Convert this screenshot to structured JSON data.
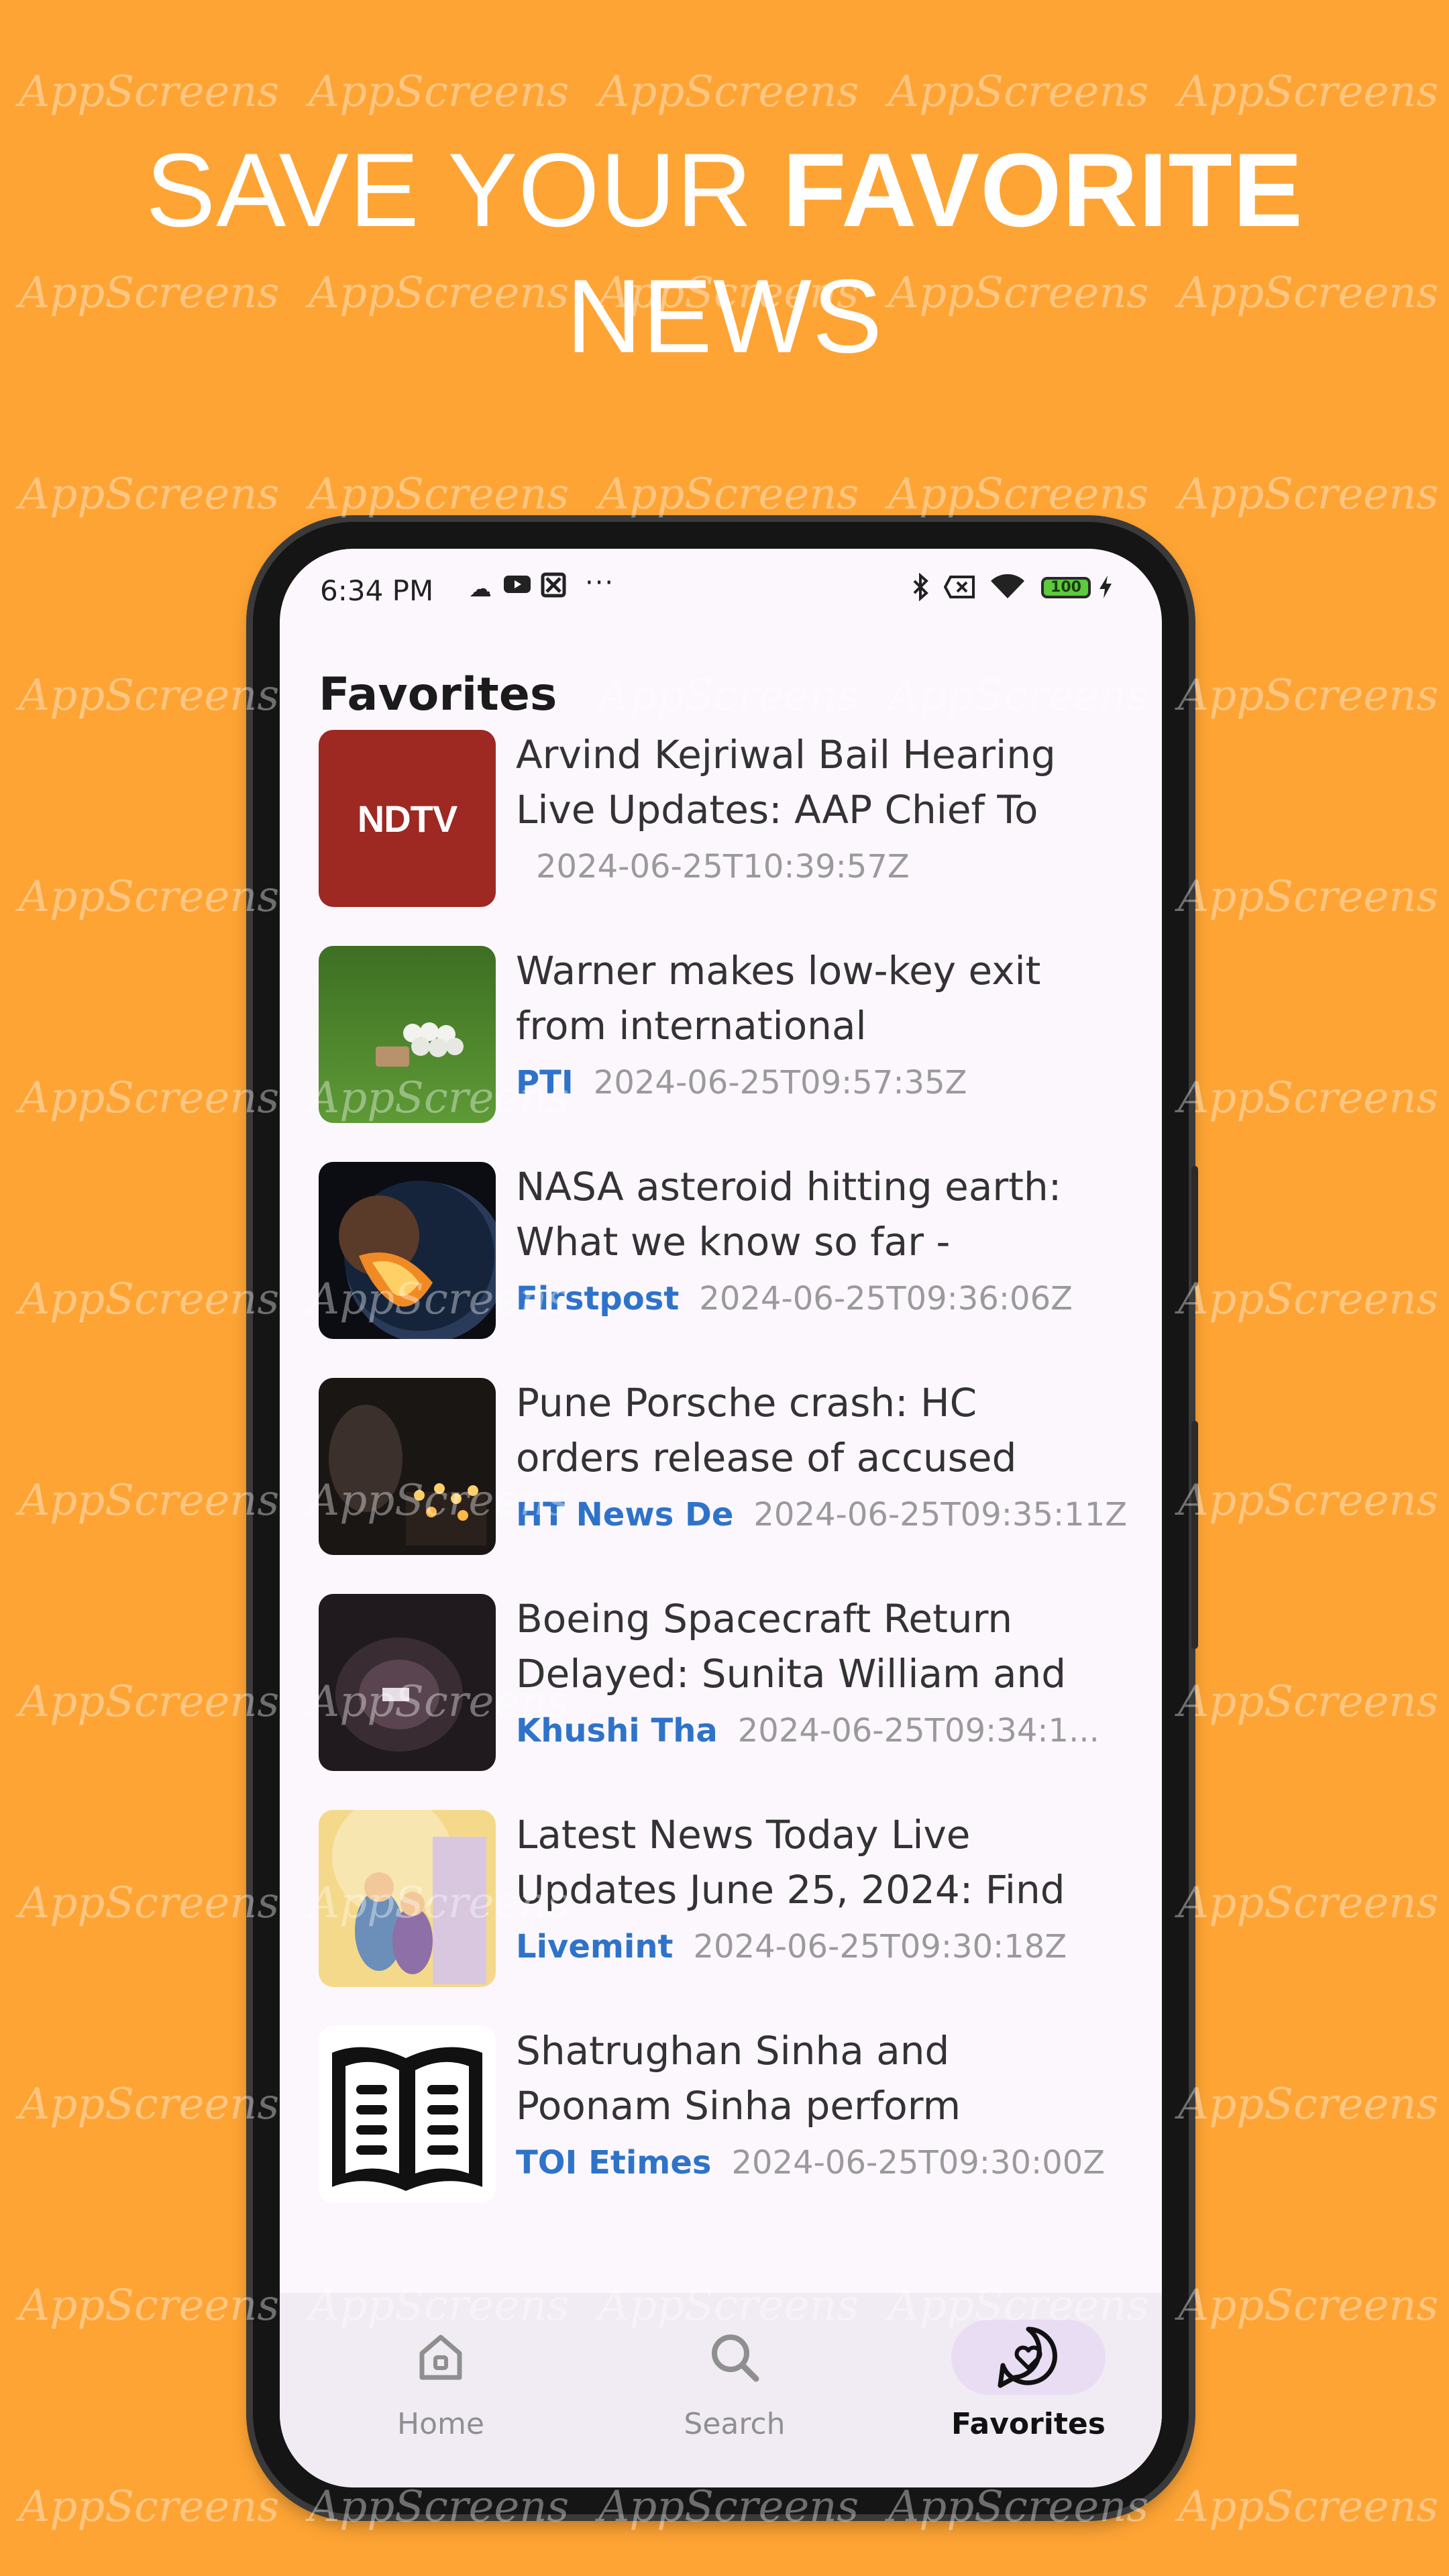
{
  "watermark": "AppScreens",
  "headline": {
    "prefix": "SAVE YOUR ",
    "bold": "FAVORITE",
    "line2": "NEWS"
  },
  "status_bar": {
    "time": "6:34 PM",
    "battery": "100"
  },
  "page_title": "Favorites",
  "articles": [
    {
      "title": "Arvind Kejriwal Bail Hearing Live Updates: AAP Chief To",
      "source": "",
      "date": "2024-06-25T10:39:57Z",
      "thumb_text": "NDTV"
    },
    {
      "title": "Warner makes low-key exit from international",
      "source": "PTI",
      "date": "2024-06-25T09:57:35Z"
    },
    {
      "title": "NASA asteroid hitting earth: What we know so far -",
      "source": "Firstpost",
      "date": "2024-06-25T09:36:06Z"
    },
    {
      "title": "Pune Porsche crash: HC orders release of accused",
      "source": "HT News De",
      "date": "2024-06-25T09:35:11Z"
    },
    {
      "title": "Boeing Spacecraft Return Delayed: Sunita William and",
      "source": "Khushi Tha",
      "date": "2024-06-25T09:34:1..."
    },
    {
      "title": "Latest News Today Live Updates June 25, 2024: Find",
      "source": "Livemint",
      "date": "2024-06-25T09:30:18Z"
    },
    {
      "title": "Shatrughan Sinha and Poonam Sinha perform",
      "source": "TOI Etimes",
      "date": "2024-06-25T09:30:00Z"
    }
  ],
  "nav": {
    "home": "Home",
    "search": "Search",
    "favorites": "Favorites"
  },
  "colors": {
    "background": "#FEA434",
    "source_link": "#2E73C9",
    "active_pill": "#E9DDF4"
  }
}
